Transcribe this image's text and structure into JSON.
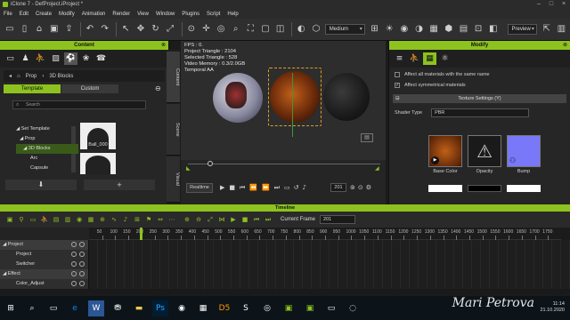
{
  "window": {
    "title": "iClone 7 - DefProject.iProject *"
  },
  "menu": [
    "File",
    "Edit",
    "Create",
    "Modify",
    "Animation",
    "Render",
    "View",
    "Window",
    "Plugins",
    "Script",
    "Help"
  ],
  "toolbar": {
    "quality": "Medium",
    "preview": "Preview"
  },
  "content_panel": {
    "title": "Content",
    "breadcrumb": [
      "Prop",
      "3D Blocks"
    ],
    "tabs": [
      "Template",
      "Custom"
    ],
    "search_placeholder": "Search",
    "tree": [
      "Set Template",
      "Prop",
      "3D Blocks",
      "Arc",
      "Capsule"
    ],
    "thumb_label": "Ball_000"
  },
  "side_tabs": [
    "Content",
    "Scene",
    "Visual"
  ],
  "viewport": {
    "info": [
      "FPS : 0.",
      "Project Triangle : 2104",
      "Selected Triangle : 528",
      "Video Memory : 0.3/2.0GB",
      "Temporal AA"
    ]
  },
  "playbar": {
    "realtime": "Realtime",
    "frame": "201"
  },
  "modify_panel": {
    "title": "Modify",
    "check_same": "Affect all materials with the same name",
    "check_sym": "Affect symmetrical materials",
    "texture_header": "Texture Settings (Y)",
    "shader_label": "Shader Type",
    "shader_value": "PBR",
    "slots": [
      "Base Color",
      "Opacity",
      "Bump"
    ]
  },
  "timeline": {
    "title": "Timeline",
    "current_frame_label": "Current Frame",
    "current_frame": "201",
    "ruler": [
      "50",
      "100",
      "150",
      "200",
      "250",
      "300",
      "350",
      "400",
      "450",
      "500",
      "550",
      "600",
      "650",
      "700",
      "750",
      "800",
      "850",
      "900",
      "950",
      "1000",
      "1050",
      "1100",
      "1150",
      "1200",
      "1250",
      "1300",
      "1350",
      "1400",
      "1450",
      "1500",
      "1550",
      "1600",
      "1650",
      "1700",
      "1750"
    ],
    "tracks": [
      {
        "label": "Project",
        "header": true
      },
      {
        "label": "Project",
        "header": false
      },
      {
        "label": "Switcher",
        "header": false
      },
      {
        "label": "Effect",
        "header": true
      },
      {
        "label": "Color_Adjust",
        "header": false
      }
    ]
  },
  "taskbar": {
    "time": "11:14",
    "date": "21.10.2020",
    "signature": "Mari Petrova"
  }
}
